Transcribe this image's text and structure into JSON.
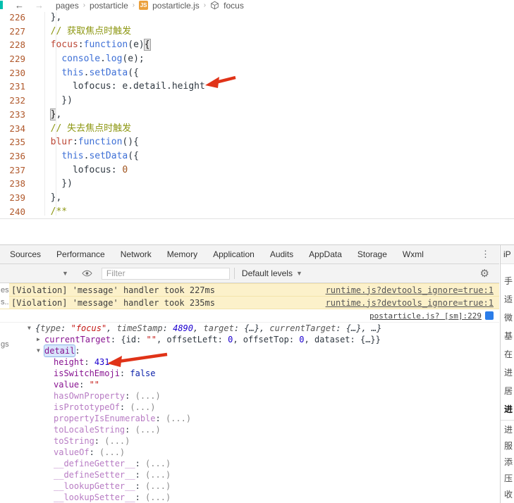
{
  "colors": {
    "annotation_arrow": "#e03318",
    "violation_bg": "#fcf1ca",
    "accent_teal": "#00bfae",
    "selection_bg": "#d7e6fb"
  },
  "breadcrumb": {
    "back_icon": "←",
    "forward_icon": "→",
    "separator": "›",
    "js_badge": "JS",
    "items": [
      {
        "label": "pages"
      },
      {
        "label": "postarticle"
      },
      {
        "label": "postarticle.js",
        "icon": "js"
      },
      {
        "label": "focus",
        "icon": "cube"
      }
    ]
  },
  "editor": {
    "lines": [
      {
        "n": "226",
        "s": [
          [
            "p",
            "  },"
          ]
        ]
      },
      {
        "n": "227",
        "s": [
          [
            "p",
            "  "
          ],
          [
            "c",
            "// 获取焦点时触发"
          ]
        ]
      },
      {
        "n": "228",
        "s": [
          [
            "p",
            "  "
          ],
          [
            "k",
            "focus"
          ],
          [
            "p",
            ":"
          ],
          [
            "w",
            "function"
          ],
          [
            "p",
            "(e)"
          ],
          [
            "x",
            "{"
          ]
        ]
      },
      {
        "n": "229",
        "s": [
          [
            "p",
            "    "
          ],
          [
            "b",
            "console"
          ],
          [
            "p",
            "."
          ],
          [
            "b",
            "log"
          ],
          [
            "p",
            "(e);"
          ]
        ]
      },
      {
        "n": "230",
        "s": [
          [
            "p",
            "    "
          ],
          [
            "w",
            "this"
          ],
          [
            "p",
            "."
          ],
          [
            "b",
            "setData"
          ],
          [
            "p",
            "({"
          ]
        ]
      },
      {
        "n": "231",
        "s": [
          [
            "p",
            "      lofocus: e.detail.height"
          ]
        ]
      },
      {
        "n": "232",
        "s": [
          [
            "p",
            "    })"
          ]
        ]
      },
      {
        "n": "233",
        "s": [
          [
            "p",
            "  "
          ],
          [
            "x",
            "}"
          ],
          [
            "p",
            ","
          ]
        ]
      },
      {
        "n": "234",
        "s": [
          [
            "p",
            "  "
          ],
          [
            "c",
            "// 失去焦点时触发"
          ]
        ]
      },
      {
        "n": "235",
        "s": [
          [
            "p",
            "  "
          ],
          [
            "k",
            "blur"
          ],
          [
            "p",
            ":"
          ],
          [
            "w",
            "function"
          ],
          [
            "p",
            "(){"
          ]
        ]
      },
      {
        "n": "236",
        "s": [
          [
            "p",
            "    "
          ],
          [
            "w",
            "this"
          ],
          [
            "p",
            "."
          ],
          [
            "b",
            "setData"
          ],
          [
            "p",
            "({"
          ]
        ]
      },
      {
        "n": "237",
        "s": [
          [
            "p",
            "      lofocus: "
          ],
          [
            "n",
            "0"
          ]
        ]
      },
      {
        "n": "238",
        "s": [
          [
            "p",
            "    })"
          ]
        ]
      },
      {
        "n": "239",
        "s": [
          [
            "p",
            "  },"
          ]
        ]
      },
      {
        "n": "240",
        "s": [
          [
            "p",
            "  "
          ],
          [
            "c",
            "/**"
          ]
        ]
      }
    ]
  },
  "devtools": {
    "tabs": [
      "Sources",
      "Performance",
      "Network",
      "Memory",
      "Application",
      "Audits",
      "AppData",
      "Storage",
      "Wxml"
    ],
    "overflow_menu": "⋮",
    "device_label": "iP",
    "toolbar": {
      "caret": "▼",
      "filter_label": "Filter",
      "levels_label": "Default levels",
      "gear": "⚙"
    },
    "console": {
      "left_fragments": [
        {
          "t": "es",
          "y": 4
        },
        {
          "t": "s..",
          "y": 21
        },
        {
          "t": "gs",
          "y": 81
        }
      ],
      "violations": [
        {
          "text": "[Violation] 'message' handler took 227ms",
          "link": "runtime.js?devtools_ignore=true:1"
        },
        {
          "text": "[Violation] 'message' handler took 235ms",
          "link": "runtime.js?devtools_ignore=true:1"
        }
      ],
      "source_link": "postarticle.js? [sm]:229",
      "tree": [
        {
          "arrow": "▼",
          "indent": 0,
          "italic": true,
          "s": [
            [
              "p",
              "{"
            ],
            [
              "pk",
              "type"
            ],
            [
              "p",
              ": "
            ],
            [
              "st",
              "\"focus\""
            ],
            [
              "p",
              ", "
            ],
            [
              "pk",
              "timeStamp"
            ],
            [
              "p",
              ": "
            ],
            [
              "nu",
              "4890"
            ],
            [
              "p",
              ", "
            ],
            [
              "pk",
              "target"
            ],
            [
              "p",
              ": {…}, "
            ],
            [
              "pk",
              "currentTarget"
            ],
            [
              "p",
              ": {…}, …}"
            ]
          ]
        },
        {
          "arrow": "▶",
          "indent": 1,
          "s": [
            [
              "nm",
              "currentTarget"
            ],
            [
              "p",
              ": {id: "
            ],
            [
              "st",
              "\"\""
            ],
            [
              "p",
              ", offsetLeft: "
            ],
            [
              "nu",
              "0"
            ],
            [
              "p",
              ", offsetTop: "
            ],
            [
              "nu",
              "0"
            ],
            [
              "p",
              ", dataset: {…}}"
            ]
          ]
        },
        {
          "arrow": "▼",
          "indent": 1,
          "s": [
            [
              "sel",
              "detail"
            ],
            [
              "p",
              ":"
            ]
          ]
        },
        {
          "indent": 2,
          "s": [
            [
              "nm",
              "height"
            ],
            [
              "p",
              ": "
            ],
            [
              "nu",
              "431"
            ]
          ]
        },
        {
          "indent": 2,
          "s": [
            [
              "nm",
              "isSwitchEmoji"
            ],
            [
              "p",
              ": "
            ],
            [
              "bl",
              "false"
            ]
          ]
        },
        {
          "indent": 2,
          "s": [
            [
              "nm",
              "value"
            ],
            [
              "p",
              ": "
            ],
            [
              "st",
              "\"\""
            ]
          ]
        },
        {
          "indent": 2,
          "s": [
            [
              "f",
              "hasOwnProperty"
            ],
            [
              "p",
              ": "
            ],
            [
              "g",
              "(...)"
            ]
          ]
        },
        {
          "indent": 2,
          "s": [
            [
              "f",
              "isPrototypeOf"
            ],
            [
              "p",
              ": "
            ],
            [
              "g",
              "(...)"
            ]
          ]
        },
        {
          "indent": 2,
          "s": [
            [
              "f",
              "propertyIsEnumerable"
            ],
            [
              "p",
              ": "
            ],
            [
              "g",
              "(...)"
            ]
          ]
        },
        {
          "indent": 2,
          "s": [
            [
              "f",
              "toLocaleString"
            ],
            [
              "p",
              ": "
            ],
            [
              "g",
              "(...)"
            ]
          ]
        },
        {
          "indent": 2,
          "s": [
            [
              "f",
              "toString"
            ],
            [
              "p",
              ": "
            ],
            [
              "g",
              "(...)"
            ]
          ]
        },
        {
          "indent": 2,
          "s": [
            [
              "f",
              "valueOf"
            ],
            [
              "p",
              ": "
            ],
            [
              "g",
              "(...)"
            ]
          ]
        },
        {
          "indent": 2,
          "s": [
            [
              "f",
              "__defineGetter__"
            ],
            [
              "p",
              ": "
            ],
            [
              "g",
              "(...)"
            ]
          ]
        },
        {
          "indent": 2,
          "s": [
            [
              "f",
              "__defineSetter__"
            ],
            [
              "p",
              ": "
            ],
            [
              "g",
              "(...)"
            ]
          ]
        },
        {
          "indent": 2,
          "s": [
            [
              "f",
              "__lookupGetter__"
            ],
            [
              "p",
              ": "
            ],
            [
              "g",
              "(...)"
            ]
          ]
        },
        {
          "indent": 2,
          "s": [
            [
              "f",
              "__lookupSetter__"
            ],
            [
              "p",
              ": "
            ],
            [
              "g",
              "(...)"
            ]
          ]
        }
      ]
    }
  },
  "right_sidebar": {
    "groups": [
      {
        "items": [
          {
            "t": "手"
          },
          {
            "t": "适"
          },
          {
            "t": "微"
          },
          {
            "t": "基"
          },
          {
            "t": "在"
          },
          {
            "t": "进"
          },
          {
            "t": "居"
          },
          {
            "t": "进",
            "bold": true
          }
        ]
      },
      {
        "compact": true,
        "items": [
          {
            "t": "进"
          },
          {
            "t": "服"
          },
          {
            "t": "添"
          },
          {
            "t": "压"
          },
          {
            "t": "收"
          }
        ]
      }
    ]
  }
}
